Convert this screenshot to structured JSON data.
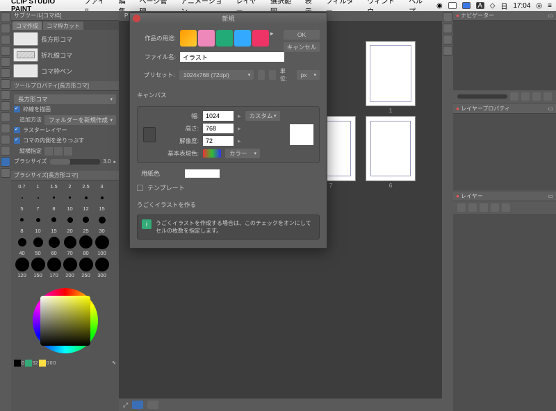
{
  "menubar": {
    "app": "CLIP STUDIO PAINT",
    "items": [
      "ファイル",
      "編集",
      "ページ管理",
      "アニメーション",
      "レイヤー",
      "選択範囲",
      "表示",
      "フィルター",
      "ウィンドウ",
      "ヘルプ"
    ],
    "right": {
      "day": "日",
      "time": "17:04"
    }
  },
  "doc": {
    "title": "P STUDIO PAINT EX",
    "pages": [
      "1",
      "?",
      "7",
      "6"
    ]
  },
  "subtool": {
    "panel_title": "サブツール[コマ枠]",
    "tabs": [
      "コマ作成",
      "コマ枠カット"
    ],
    "items": [
      "長方形コマ",
      "折れ線コマ",
      "コマ枠ペン"
    ]
  },
  "toolprop": {
    "title": "ツールプロパティ[長方形コマ]",
    "preset": "長方形コマ",
    "rows": [
      {
        "chk": true,
        "label": "枠線を描画"
      },
      {
        "chk": false,
        "label": "追加方法",
        "val": "フォルダーを新規作成"
      },
      {
        "chk": true,
        "label": "ラスターレイヤー"
      },
      {
        "chk": true,
        "label": "コマの内側を塗りつぶす"
      },
      {
        "chk": false,
        "label": "縦横指定"
      }
    ],
    "brush_label": "ブラシサイズ",
    "brush_val": "3.0"
  },
  "brush": {
    "title": "ブラシサイズ[長方形コマ]",
    "r1": [
      "0.7",
      "1",
      "1.5",
      "2",
      "2.5",
      "3"
    ],
    "r2": [
      "5",
      "7",
      "8",
      "10",
      "12",
      "15"
    ],
    "r3": [
      "8",
      "10",
      "15",
      "20",
      "25",
      "30"
    ],
    "r4": [
      "40",
      "50",
      "60",
      "70",
      "80",
      "100"
    ],
    "r5": [
      "120",
      "150",
      "170",
      "200",
      "250",
      "300"
    ]
  },
  "colorbar": {
    "vals": [
      "0",
      "52",
      "0",
      "0",
      "0"
    ]
  },
  "nav": {
    "title": "ナビゲーター"
  },
  "layerprop": {
    "title": "レイヤープロパティ"
  },
  "layer": {
    "title": "レイヤー"
  },
  "dialog": {
    "title": "新規",
    "ok": "OK",
    "cancel": "キャンセル",
    "usage_label": "作品の用途:",
    "filename_label": "ファイル名:",
    "filename": "イラスト",
    "preset_label": "プリセット:",
    "preset": "1024x768 (72dpi)",
    "unit_label": "単位:",
    "unit": "px",
    "canvas_hdr": "キャンバス",
    "w_label": "幅:",
    "w": "1024",
    "h_label": "高さ:",
    "h": "768",
    "res_label": "解像度:",
    "res": "72",
    "custom": "カスタム",
    "basecolor_label": "基本表現色:",
    "basecolor": "カラー",
    "paper_chk": "用紙色",
    "template_chk": "テンプレート",
    "anim_hdr": "うごくイラストを作る",
    "anim_info": "うごくイラストを作成する場合は、このチェックをオンにしてセルの枚数を指定します。"
  }
}
